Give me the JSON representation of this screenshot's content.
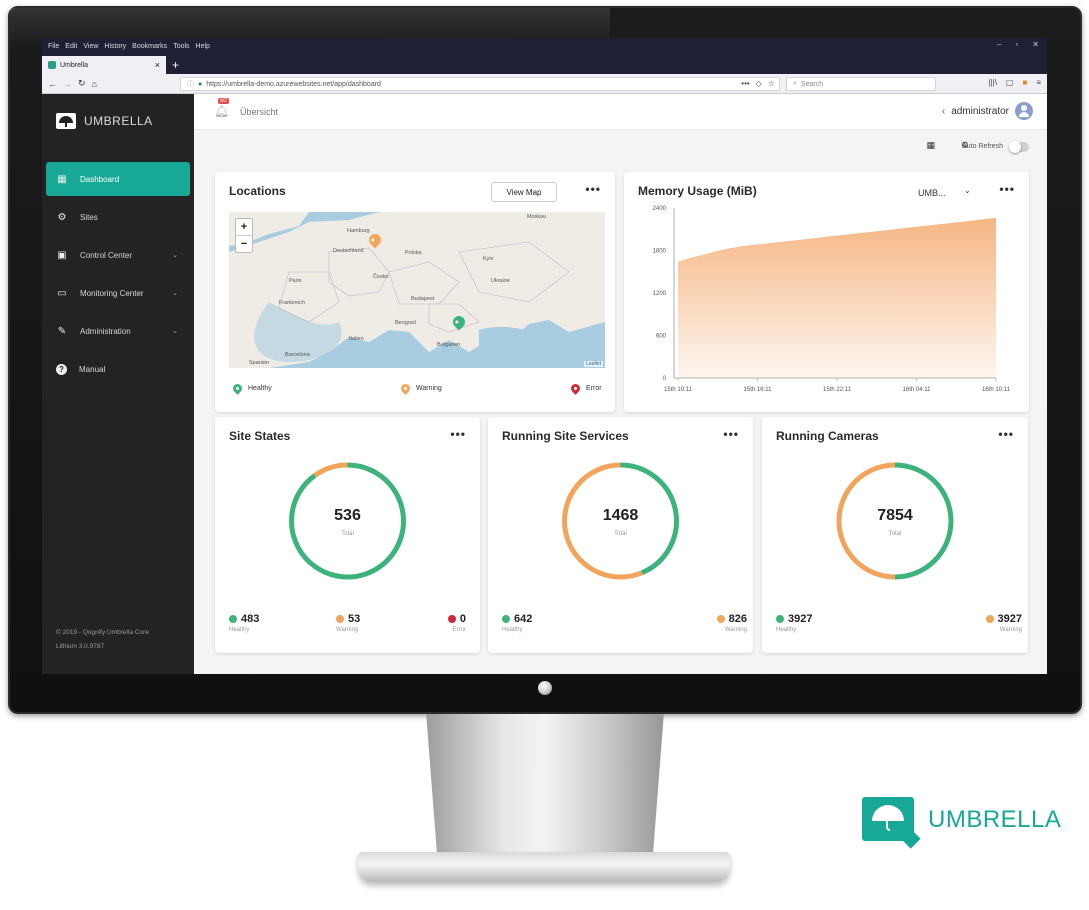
{
  "browser": {
    "menu": [
      "File",
      "Edit",
      "View",
      "History",
      "Bookmarks",
      "Tools",
      "Help"
    ],
    "tab_title": "Umbrella",
    "url": "https://umbrella-demo.azurewebsites.net/app/dashboard",
    "search_placeholder": "Search",
    "window_controls": [
      "–",
      "▫",
      "✕"
    ]
  },
  "app": {
    "brand": "UMBRELLA",
    "page_title": "Übersicht",
    "notification_count": "50",
    "user_name": "administrator",
    "auto_refresh_label": "Auto Refresh",
    "auto_refresh_on": false,
    "footer_line1": "© 2019 - Qognify Umbrella Core",
    "footer_line2": "Lithium 3.0.9787"
  },
  "sidebar": {
    "items": [
      {
        "label": "Dashboard",
        "icon": "dashboard-icon",
        "active": true,
        "has_chevron": false
      },
      {
        "label": "Sites",
        "icon": "gears-icon",
        "active": false,
        "has_chevron": false
      },
      {
        "label": "Control Center",
        "icon": "control-center-icon",
        "active": false,
        "has_chevron": true
      },
      {
        "label": "Monitoring Center",
        "icon": "monitor-icon",
        "active": false,
        "has_chevron": true
      },
      {
        "label": "Administration",
        "icon": "wrench-icon",
        "active": false,
        "has_chevron": true
      },
      {
        "label": "Manual",
        "icon": "help-icon",
        "active": false,
        "has_chevron": false
      }
    ]
  },
  "locations": {
    "title": "Locations",
    "view_map_label": "View Map",
    "menu_label": "•••",
    "zoom_in": "+",
    "zoom_out": "−",
    "attribution": "Leaflet",
    "map_labels": [
      "Hamburg",
      "Deutschland",
      "Polska",
      "Paris",
      "Česko",
      "Frankreich",
      "Budapest",
      "Beograd",
      "Italien",
      "Barcelona",
      "Spanien",
      "Bulgarien",
      "Ukraine",
      "Kyiv",
      "Moskau"
    ],
    "legend": [
      {
        "label": "Healthy",
        "color": "#3cb37c"
      },
      {
        "label": "Warning",
        "color": "#f2a55a"
      },
      {
        "label": "Error",
        "color": "#cc2a36"
      }
    ]
  },
  "memory": {
    "title": "Memory Usage (MiB)",
    "select_value": "UMB...",
    "menu_label": "•••",
    "chart_data": {
      "type": "area",
      "x_ticks": [
        "15th 10:11",
        "15th 16:11",
        "15th 22:11",
        "16th 04:11",
        "16th 10:11"
      ],
      "y_ticks": [
        0,
        600,
        1200,
        1800,
        2400
      ],
      "ylim": [
        0,
        2400
      ],
      "fill_color": "#f5b27d",
      "values": [
        1640,
        1700,
        1740,
        1790,
        1830,
        1860,
        1880,
        1900,
        1920,
        1940,
        1960,
        1980,
        2000,
        2020,
        2040,
        2060,
        2080,
        2100,
        2120,
        2140,
        2160,
        2180,
        2200,
        2220,
        2240,
        2260
      ]
    }
  },
  "site_states": {
    "title": "Site States",
    "menu_label": "•••",
    "total": "536",
    "total_label": "Total",
    "stats": [
      {
        "value": "483",
        "label": "Healthy",
        "color": "#3cb37c"
      },
      {
        "value": "53",
        "label": "Warning",
        "color": "#f2a55a"
      },
      {
        "value": "0",
        "label": "Error",
        "color": "#cc2a36"
      }
    ]
  },
  "site_services": {
    "title": "Running Site Services",
    "menu_label": "•••",
    "total": "1468",
    "total_label": "Total",
    "stats": [
      {
        "value": "642",
        "label": "Healthy",
        "color": "#3cb37c"
      },
      {
        "value": "826",
        "label": "Warning",
        "color": "#f2a55a"
      }
    ]
  },
  "cameras": {
    "title": "Running Cameras",
    "menu_label": "•••",
    "total": "7854",
    "total_label": "Total",
    "stats": [
      {
        "value": "3927",
        "label": "Healthy",
        "color": "#3cb37c"
      },
      {
        "value": "3927",
        "label": "Warning",
        "color": "#f2a55a"
      }
    ]
  },
  "corner_logo": {
    "text": "UMBRELLA",
    "color": "#17a896"
  }
}
